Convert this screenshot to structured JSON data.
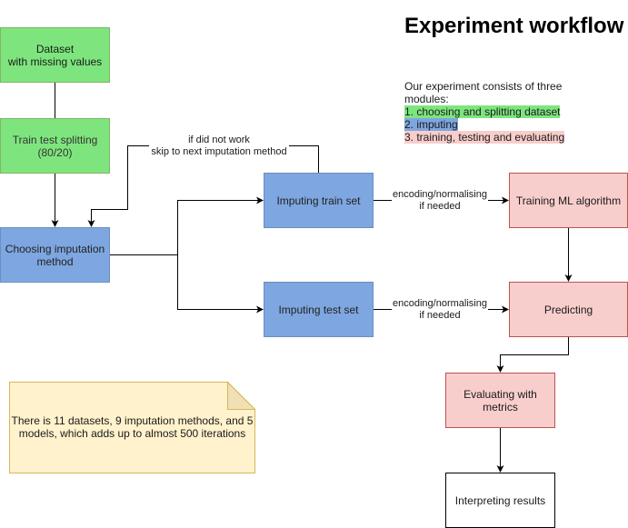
{
  "title": "Experiment workflow",
  "description": {
    "intro": "Our experiment consists of three modules:",
    "modules": [
      {
        "text": "1. choosing and splitting dataset",
        "color": "#7ee57e"
      },
      {
        "text": "2. imputing",
        "color": "#7ea6e0"
      },
      {
        "text": "3. training, testing and evaluating",
        "color": "#f8cecc"
      }
    ]
  },
  "nodes": {
    "dataset": "Dataset\nwith missing values",
    "split": "Train test splitting\n(80/20)",
    "choose": "Choosing imputation\nmethod",
    "impute_train": "Imputing train set",
    "impute_test": "Imputing test set",
    "training": "Training ML algorithm",
    "predicting": "Predicting",
    "evaluating": "Evaluating with\nmetrics",
    "interpreting": "Interpreting results"
  },
  "edge_labels": {
    "retry": "if did not work\nskip to next imputation method",
    "encode_train": "encoding/normalising\nif needed",
    "encode_test": "encoding/normalising\nif needed"
  },
  "note": "There is 11 datasets, 9 imputation methods, and 5 models, which adds up to almost 500 iterations",
  "colors": {
    "module1": "#7ee57e",
    "module2": "#7ea6e0",
    "module3": "#f8cecc",
    "note": "#fff2cc"
  }
}
